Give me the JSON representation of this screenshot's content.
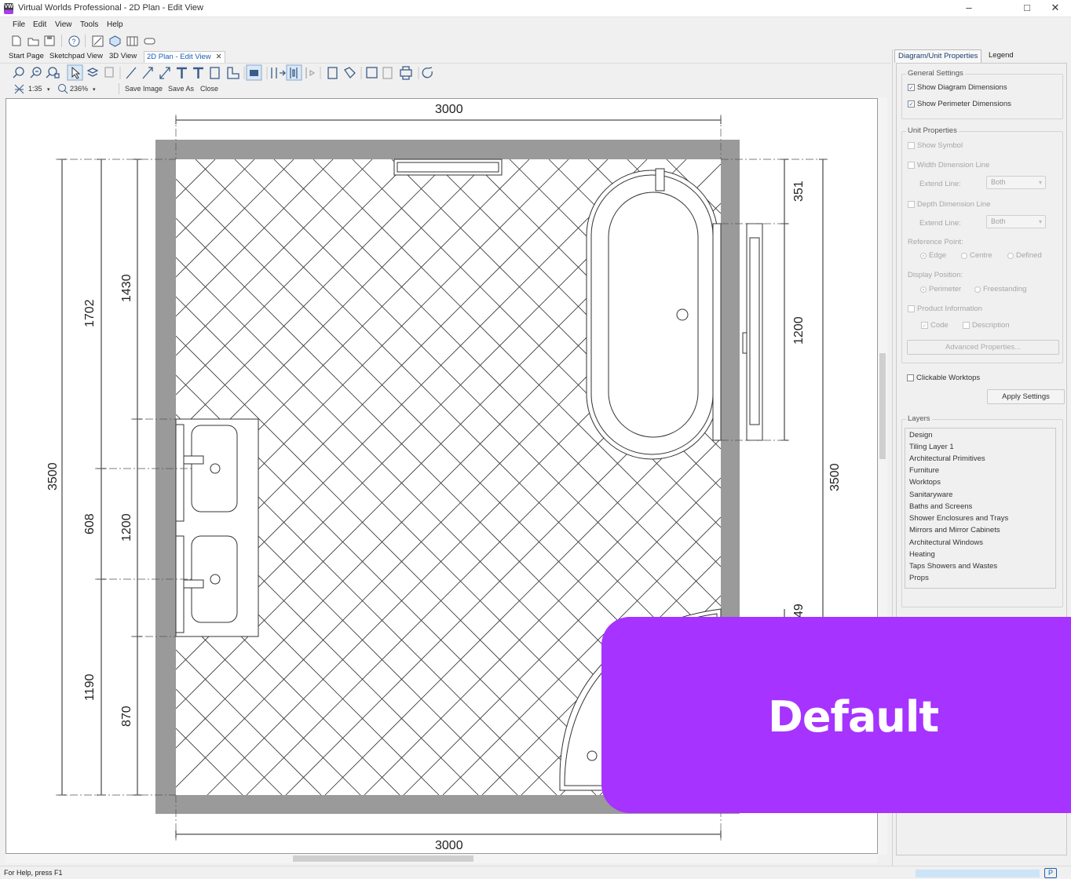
{
  "window": {
    "title": "Virtual Worlds Professional - 2D Plan - Edit View",
    "logo_text": "VW",
    "controls": [
      "–",
      "□",
      "✕"
    ]
  },
  "menu": [
    "File",
    "Edit",
    "View",
    "Tools",
    "Help"
  ],
  "doc_tabs": [
    {
      "label": "Start Page",
      "active": false
    },
    {
      "label": "Sketchpad View",
      "active": false
    },
    {
      "label": "3D View",
      "active": false
    },
    {
      "label": "2D Plan - Edit View",
      "active": true,
      "close": "✕"
    }
  ],
  "toolbar3": {
    "scale": "1:35",
    "zoom": "236%",
    "save_image": "Save Image",
    "save_as": "Save As",
    "close": "Close"
  },
  "plan": {
    "dimensions": {
      "top": "3000",
      "bottom": "3000",
      "left_overall": "3500",
      "right_overall": "3500",
      "left_outer": [
        "1702",
        "608",
        "1190"
      ],
      "left_inner": [
        "1430",
        "1200",
        "870"
      ],
      "right_inner": [
        "351",
        "1200",
        "49"
      ]
    }
  },
  "panel": {
    "tabs": {
      "properties": "Diagram/Unit Properties",
      "legend": "Legend"
    },
    "general": {
      "label": "General Settings",
      "show_diagram_dimensions": "Show Diagram Dimensions",
      "show_perimeter_dimensions": "Show Perimeter Dimensions"
    },
    "unit": {
      "label": "Unit Properties",
      "show_symbol": "Show Symbol",
      "width_dimension_line": "Width Dimension Line",
      "extend_line_1": "Extend Line:",
      "extend_value_1": "Both",
      "depth_dimension_line": "Depth Dimension Line",
      "extend_line_2": "Extend Line:",
      "extend_value_2": "Both",
      "reference_point": "Reference Point:",
      "ref_edge": "Edge",
      "ref_centre": "Centre",
      "ref_defined": "Defined",
      "display_position": "Display Position:",
      "pos_perimeter": "Perimeter",
      "pos_freestanding": "Freestanding",
      "product_information": "Product Information",
      "code": "Code",
      "description": "Description",
      "advanced": "Advanced Properties..."
    },
    "clickable_worktops": "Clickable Worktops",
    "apply_settings": "Apply Settings",
    "layers_label": "Layers",
    "layers": [
      "Design",
      "Tiling Layer 1",
      "Architectural Primitives",
      "Furniture",
      "Worktops",
      "Sanitaryware",
      "Baths and Screens",
      "Shower Enclosures and Trays",
      "Mirrors and Mirror Cabinets",
      "Architectural Windows",
      "Heating",
      "Taps Showers and Wastes",
      "Props"
    ]
  },
  "status": {
    "text": "For Help, press F1",
    "badge": "P"
  },
  "overlay": {
    "text": "Default",
    "color": "#a633ff"
  }
}
